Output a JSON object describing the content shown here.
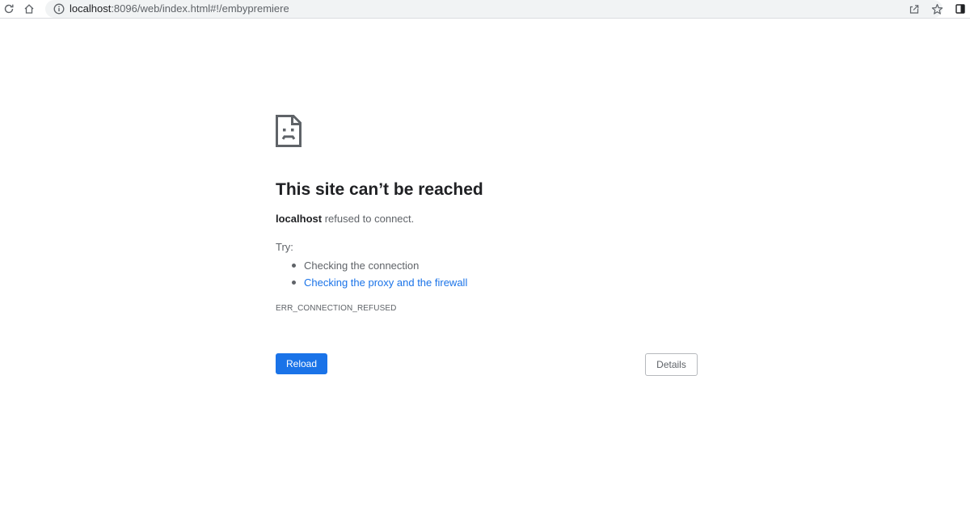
{
  "toolbar": {
    "reload_icon": "reload-icon",
    "home_icon": "home-icon",
    "info_icon": "info-icon",
    "url_host": "localhost",
    "url_rest": ":8096/web/index.html#!/embypremiere",
    "share_icon": "share-icon",
    "star_icon": "star-icon",
    "sidepanel_icon": "side-panel-icon"
  },
  "error": {
    "icon": "sad-page-icon",
    "heading": "This site can’t be reached",
    "host": "localhost",
    "summary_rest": " refused to connect.",
    "try_label": "Try:",
    "suggestions": [
      "Checking the connection",
      "Checking the proxy and the firewall"
    ],
    "code": "ERR_CONNECTION_REFUSED",
    "reload_label": "Reload",
    "details_label": "Details"
  },
  "colors": {
    "accent": "#1a73e8",
    "heading": "#202124",
    "body_text": "#5f6368"
  }
}
